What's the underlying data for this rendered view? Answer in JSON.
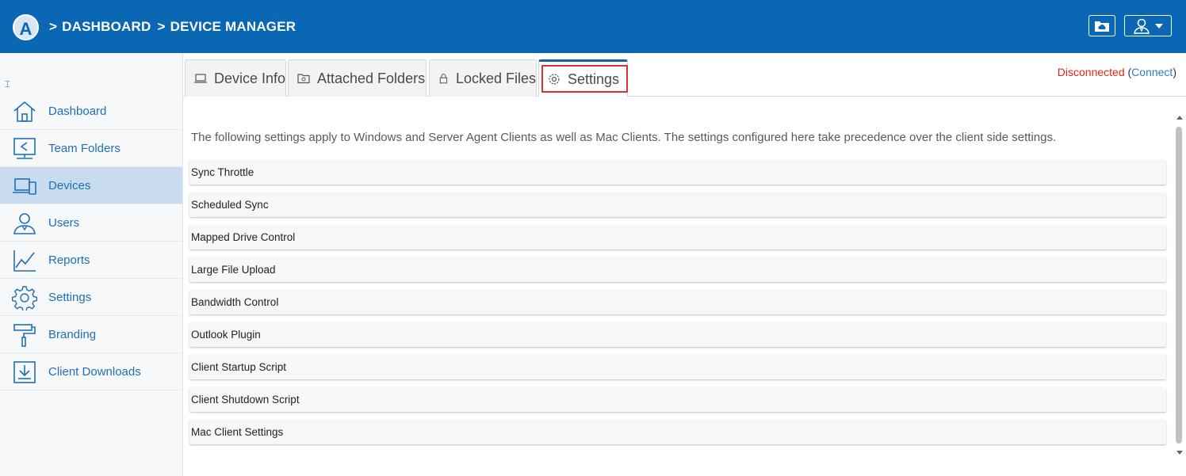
{
  "header": {
    "logo_letter": "A",
    "breadcrumb": [
      ">",
      "DASHBOARD",
      ">",
      "DEVICE MANAGER"
    ],
    "folder_button_icon": "cloud-folder-icon",
    "user_button_icon": "user-icon"
  },
  "sidebar": {
    "collapse_icon": "⌶",
    "items": [
      {
        "label": "Dashboard",
        "icon": "home-icon"
      },
      {
        "label": "Team Folders",
        "icon": "team-folders-icon"
      },
      {
        "label": "Devices",
        "icon": "devices-icon",
        "active": true
      },
      {
        "label": "Users",
        "icon": "users-icon"
      },
      {
        "label": "Reports",
        "icon": "reports-icon"
      },
      {
        "label": "Settings",
        "icon": "gear-icon"
      },
      {
        "label": "Branding",
        "icon": "paint-roller-icon"
      },
      {
        "label": "Client Downloads",
        "icon": "download-icon"
      }
    ]
  },
  "tabs": [
    {
      "label": "Device Info",
      "icon": "laptop-icon"
    },
    {
      "label": "Attached Folders",
      "icon": "folder-icon"
    },
    {
      "label": "Locked Files",
      "icon": "lock-icon"
    },
    {
      "label": "Settings",
      "icon": "gear-icon",
      "active": true
    }
  ],
  "status": {
    "state": "Disconnected",
    "open_paren": "(",
    "connect_link": "Connect",
    "close_paren": ")",
    "state_color": "#e2231a"
  },
  "intro_text": "The following settings apply to Windows and Server Agent Clients as well as Mac Clients. The settings configured here take precedence over the client side settings.",
  "settings_sections": [
    "Sync Throttle",
    "Scheduled Sync",
    "Mapped Drive Control",
    "Large File Upload",
    "Bandwidth Control",
    "Outlook Plugin",
    "Client Startup Script",
    "Client Shutdown Script",
    "Mac Client Settings"
  ],
  "colors": {
    "accent": "#0a67b3",
    "highlight": "#e0302f"
  }
}
